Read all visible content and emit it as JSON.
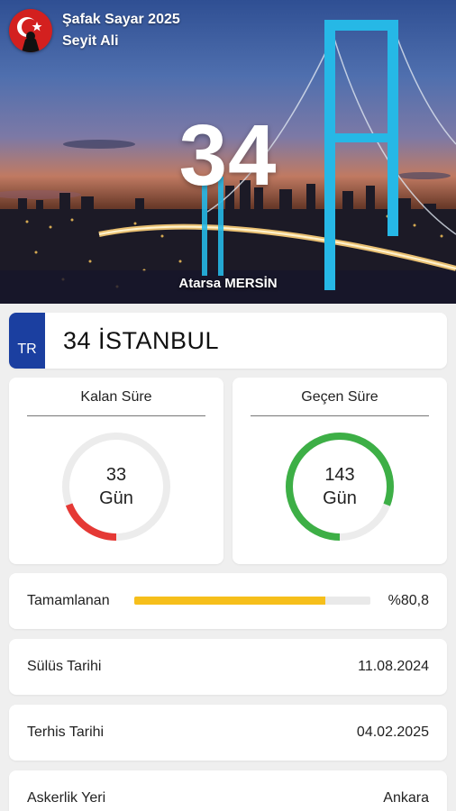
{
  "app": {
    "title": "Şafak Sayar 2025",
    "user": "Seyit Ali",
    "logo_icon": "turkish-flag-soldier-logo",
    "brand_red": "#d3201f"
  },
  "hero": {
    "big_number": "34",
    "location": "Atarsa MERSİN"
  },
  "plate": {
    "country_code": "TR",
    "text": "34 İSTANBUL",
    "band_color": "#1b3fa0"
  },
  "remaining": {
    "title": "Kalan Süre",
    "value": "33",
    "unit": "Gün",
    "ring_fraction": 0.192,
    "ring_color": "#e53935"
  },
  "elapsed": {
    "title": "Geçen Süre",
    "value": "143",
    "unit": "Gün",
    "ring_fraction": 0.808,
    "ring_color": "#3daf46"
  },
  "completed": {
    "label": "Tamamlanan",
    "value_text": "%80,8",
    "fraction": 0.808,
    "bar_color": "#f6bf1b"
  },
  "rows": [
    {
      "label": "Sülüs Tarihi",
      "value": "11.08.2024"
    },
    {
      "label": "Terhis Tarihi",
      "value": "04.02.2025"
    },
    {
      "label": "Askerlik Yeri",
      "value": "Ankara"
    }
  ]
}
